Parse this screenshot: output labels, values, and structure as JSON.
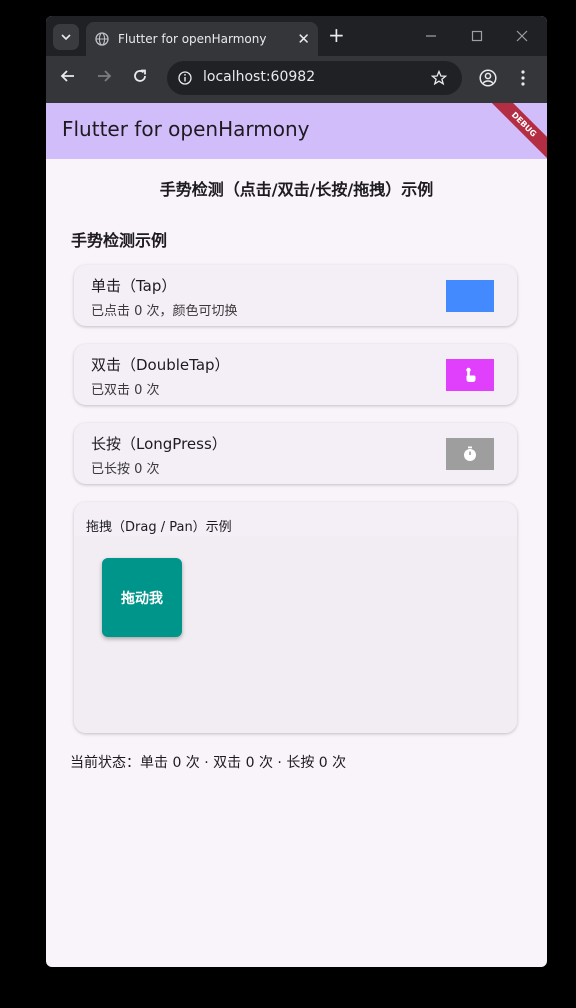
{
  "browser": {
    "tab_title": "Flutter for openHarmony",
    "url": "localhost:60982",
    "new_tab_symbol": "+",
    "close_symbol": "✕"
  },
  "app": {
    "title": "Flutter for openHarmony",
    "debug_banner": "DEBUG",
    "page_title": "手势检测（点击/双击/长按/拖拽）示例",
    "section_title": "手势检测示例"
  },
  "cards": [
    {
      "title": "单击（Tap）",
      "subtitle": "已点击 0 次，颜色可切换",
      "color": "#448aff",
      "icon": ""
    },
    {
      "title": "双击（DoubleTap）",
      "subtitle": "已双击 0 次",
      "color": "#e040fb",
      "icon": "touch-icon"
    },
    {
      "title": "长按（LongPress）",
      "subtitle": "已长按 0 次",
      "color": "#9e9e9e",
      "icon": "timer-icon"
    }
  ],
  "drag": {
    "label": "拖拽（Drag / Pan）示例",
    "box_label": "拖动我",
    "box_color": "#00958a"
  },
  "status": "当前状态：单击 0 次 · 双击 0 次 · 长按 0 次"
}
